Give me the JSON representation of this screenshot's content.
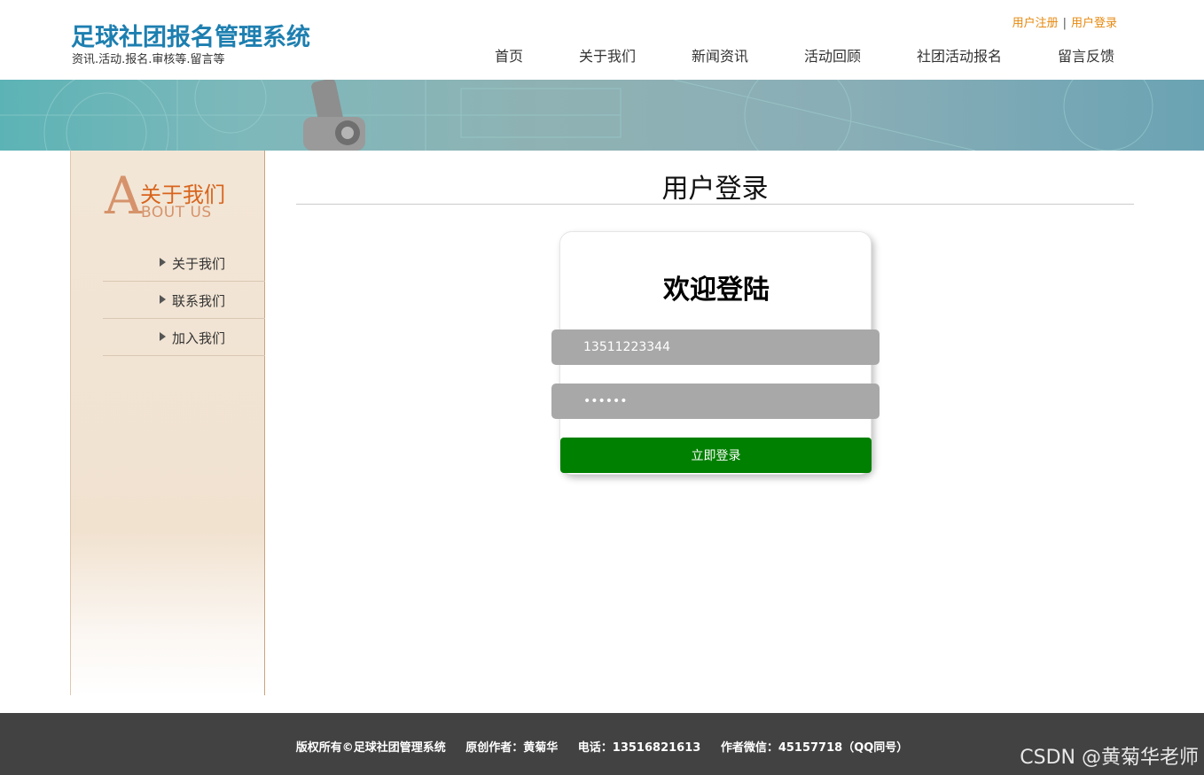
{
  "header": {
    "title": "足球社团报名管理系统",
    "subtitle": "资讯.活动.报名.审核等.留言等",
    "register_link": "用户注册",
    "separator": "|",
    "login_link": "用户登录"
  },
  "nav": {
    "items": [
      "首页",
      "关于我们",
      "新闻资讯",
      "活动回顾",
      "社团活动报名",
      "留言反馈"
    ]
  },
  "sidebar": {
    "big_letter": "A",
    "heading_cn": "关于我们",
    "heading_en": "BOUT US",
    "items": [
      "关于我们",
      "联系我们",
      "加入我们"
    ]
  },
  "main": {
    "page_title": "用户登录",
    "welcome": "欢迎登陆",
    "username_value": "13511223344",
    "password_value": "••••••",
    "submit_label": "立即登录"
  },
  "footer": {
    "copyright": "版权所有©足球社团管理系统",
    "author": "原创作者：黄菊华",
    "phone": "电话：13516821613",
    "wechat": "作者微信：45157718（QQ同号）",
    "watermark": "CSDN @黄菊华老师"
  },
  "colors": {
    "brand": "#1d7fb0",
    "link": "#e6880e",
    "accent": "#d8641c",
    "submit": "#008000",
    "footer_bg": "#424242"
  }
}
